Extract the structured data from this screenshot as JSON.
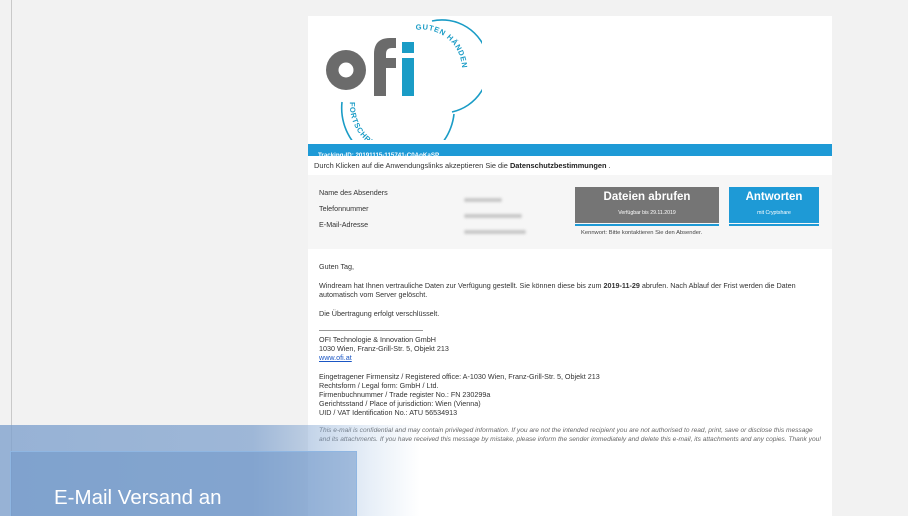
{
  "logo": {
    "wordmark": "ofi",
    "ring_text_top": "GUTEN HÄNDEN",
    "ring_text_bottom": "FORTSCHRITT IN",
    "colors": {
      "grey": "#6b6b6b",
      "teal": "#1a9cc6"
    }
  },
  "tracking": {
    "text": "Tracking-ID: 20191115-115741-C0AoKaSP"
  },
  "consent": {
    "prefix": "Durch Klicken auf die Anwendungslinks akzeptieren Sie die ",
    "link": "Datenschutzbestimmungen",
    "suffix": " ."
  },
  "sender_info": {
    "name_label": "Name des Absenders",
    "phone_label": "Telefonnummer",
    "email_label": "E-Mail-Adresse"
  },
  "buttons": {
    "download_label": "Dateien abrufen",
    "download_sub": "Verfügbar bis 29.11.2019",
    "reply_label": "Antworten",
    "reply_sub": "mit Cryptshare",
    "password_note": "Kennwort: Bitte kontaktieren Sie den Absender."
  },
  "message": {
    "greeting": "Guten Tag,",
    "line1_prefix": "Windream hat Ihnen vertrauliche Daten zur Verfügung gestellt. Sie können diese bis zum ",
    "line1_date": "2019-11-29",
    "line1_suffix": " abrufen. Nach Ablauf der Frist werden die Daten automatisch vom Server gelöscht.",
    "encryption": "Die Übertragung erfolgt verschlüsselt."
  },
  "signature": {
    "company": "OFI Technologie & Innovation GmbH",
    "address": "1030 Wien, Franz-Grill-Str. 5, Objekt 213",
    "website": "www.ofi.at"
  },
  "legal": {
    "office": "Eingetragener Firmensitz / Registered office: A-1030 Wien, Franz-Grill-Str. 5, Objekt 213",
    "form": "Rechtsform / Legal form: GmbH / Ltd.",
    "register": "Firmenbuchnummer / Trade register No.: FN 230299a",
    "jurisdiction": "Gerichtsstand / Place of jurisdiction: Wien (Vienna)",
    "vat": "UID / VAT Identification No.: ATU 56534913"
  },
  "disclaimer": "This e-mail is confidential and may contain privileged information. If you are not the intended recipient you are not authorised to read, print, save or disclose this message and its attachments. If you have received this message by mistake, please inform the sender immediately and delete this e-mail, its attachments and any copies. Thank you!",
  "caption": {
    "text": "E-Mail Versand an"
  },
  "colors": {
    "accent": "#1e9ad6",
    "button_grey": "#757575",
    "link": "#1a56c4"
  }
}
